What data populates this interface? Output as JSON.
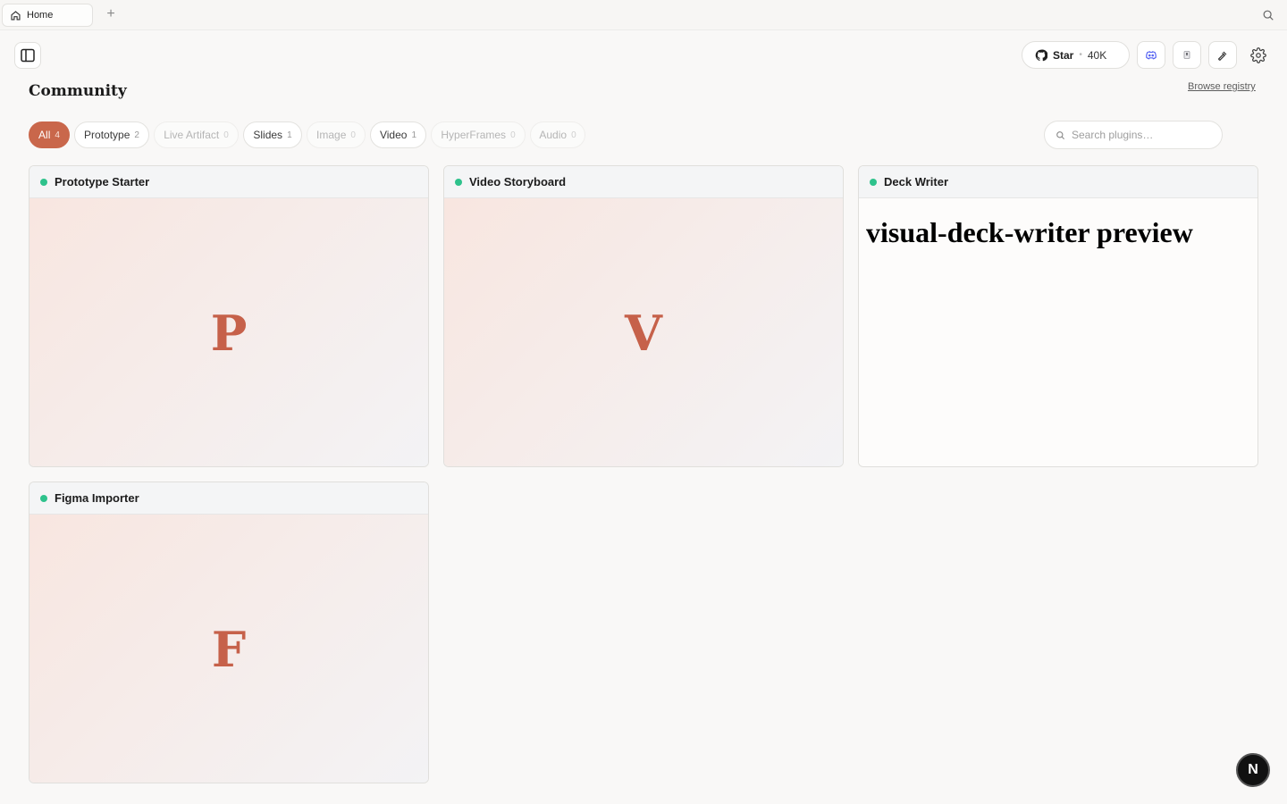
{
  "tabs": [
    {
      "label": "Home",
      "icon": "home-icon"
    }
  ],
  "header": {
    "title": "Community",
    "browse_label": "Browse registry",
    "star": {
      "label": "Star",
      "count": "40K"
    }
  },
  "filters": [
    {
      "label": "All",
      "count": "4",
      "state": "active"
    },
    {
      "label": "Prototype",
      "count": "2",
      "state": "normal"
    },
    {
      "label": "Live Artifact",
      "count": "0",
      "state": "dim"
    },
    {
      "label": "Slides",
      "count": "1",
      "state": "normal"
    },
    {
      "label": "Image",
      "count": "0",
      "state": "dim"
    },
    {
      "label": "Video",
      "count": "1",
      "state": "normal"
    },
    {
      "label": "HyperFrames",
      "count": "0",
      "state": "dim"
    },
    {
      "label": "Audio",
      "count": "0",
      "state": "dim"
    }
  ],
  "search": {
    "placeholder": "Search plugins…",
    "value": ""
  },
  "cards": [
    {
      "title": "Prototype Starter",
      "letter": "P",
      "preview": ""
    },
    {
      "title": "Video Storyboard",
      "letter": "V",
      "preview": ""
    },
    {
      "title": "Deck Writer",
      "letter": "",
      "preview": "visual-deck-writer preview"
    },
    {
      "title": "Figma Importer",
      "letter": "F",
      "preview": ""
    }
  ],
  "fab": {
    "label": "N"
  },
  "colors": {
    "accent": "#c9674b",
    "status": "#2ec28c",
    "letter": "#c6614a"
  }
}
